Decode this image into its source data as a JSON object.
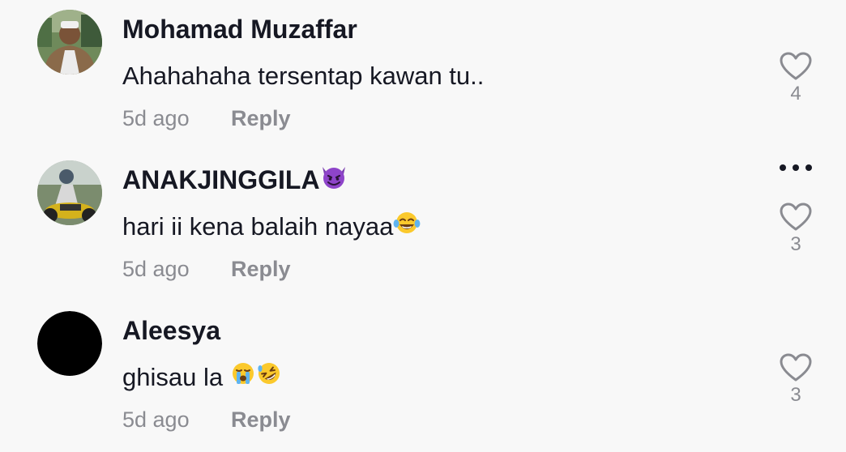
{
  "comments": [
    {
      "username": "Mohamad Muzaffar",
      "text": "Ahahahaha tersentap kawan tu..",
      "time": "5d ago",
      "reply_label": "Reply",
      "like_count": "4",
      "avatar": "photo-man-in-white-cap"
    },
    {
      "username": "ANAKJINGGILA",
      "username_emoji": "😈",
      "text": "hari ii kena balaih nayaa",
      "text_emoji": "😂",
      "time": "5d ago",
      "reply_label": "Reply",
      "like_count": "3",
      "avatar": "photo-person-on-motorbike"
    },
    {
      "username": "Aleesya",
      "text": "ghisau la ",
      "text_emoji": "😭🤣",
      "time": "5d ago",
      "reply_label": "Reply",
      "like_count": "3",
      "avatar": "black-circle"
    }
  ],
  "icons": {
    "like": "heart-outline-icon",
    "more": "more-dots-icon"
  },
  "colors": {
    "background": "#f8f8f8",
    "text_primary": "#161823",
    "text_secondary": "#8a8b91"
  }
}
